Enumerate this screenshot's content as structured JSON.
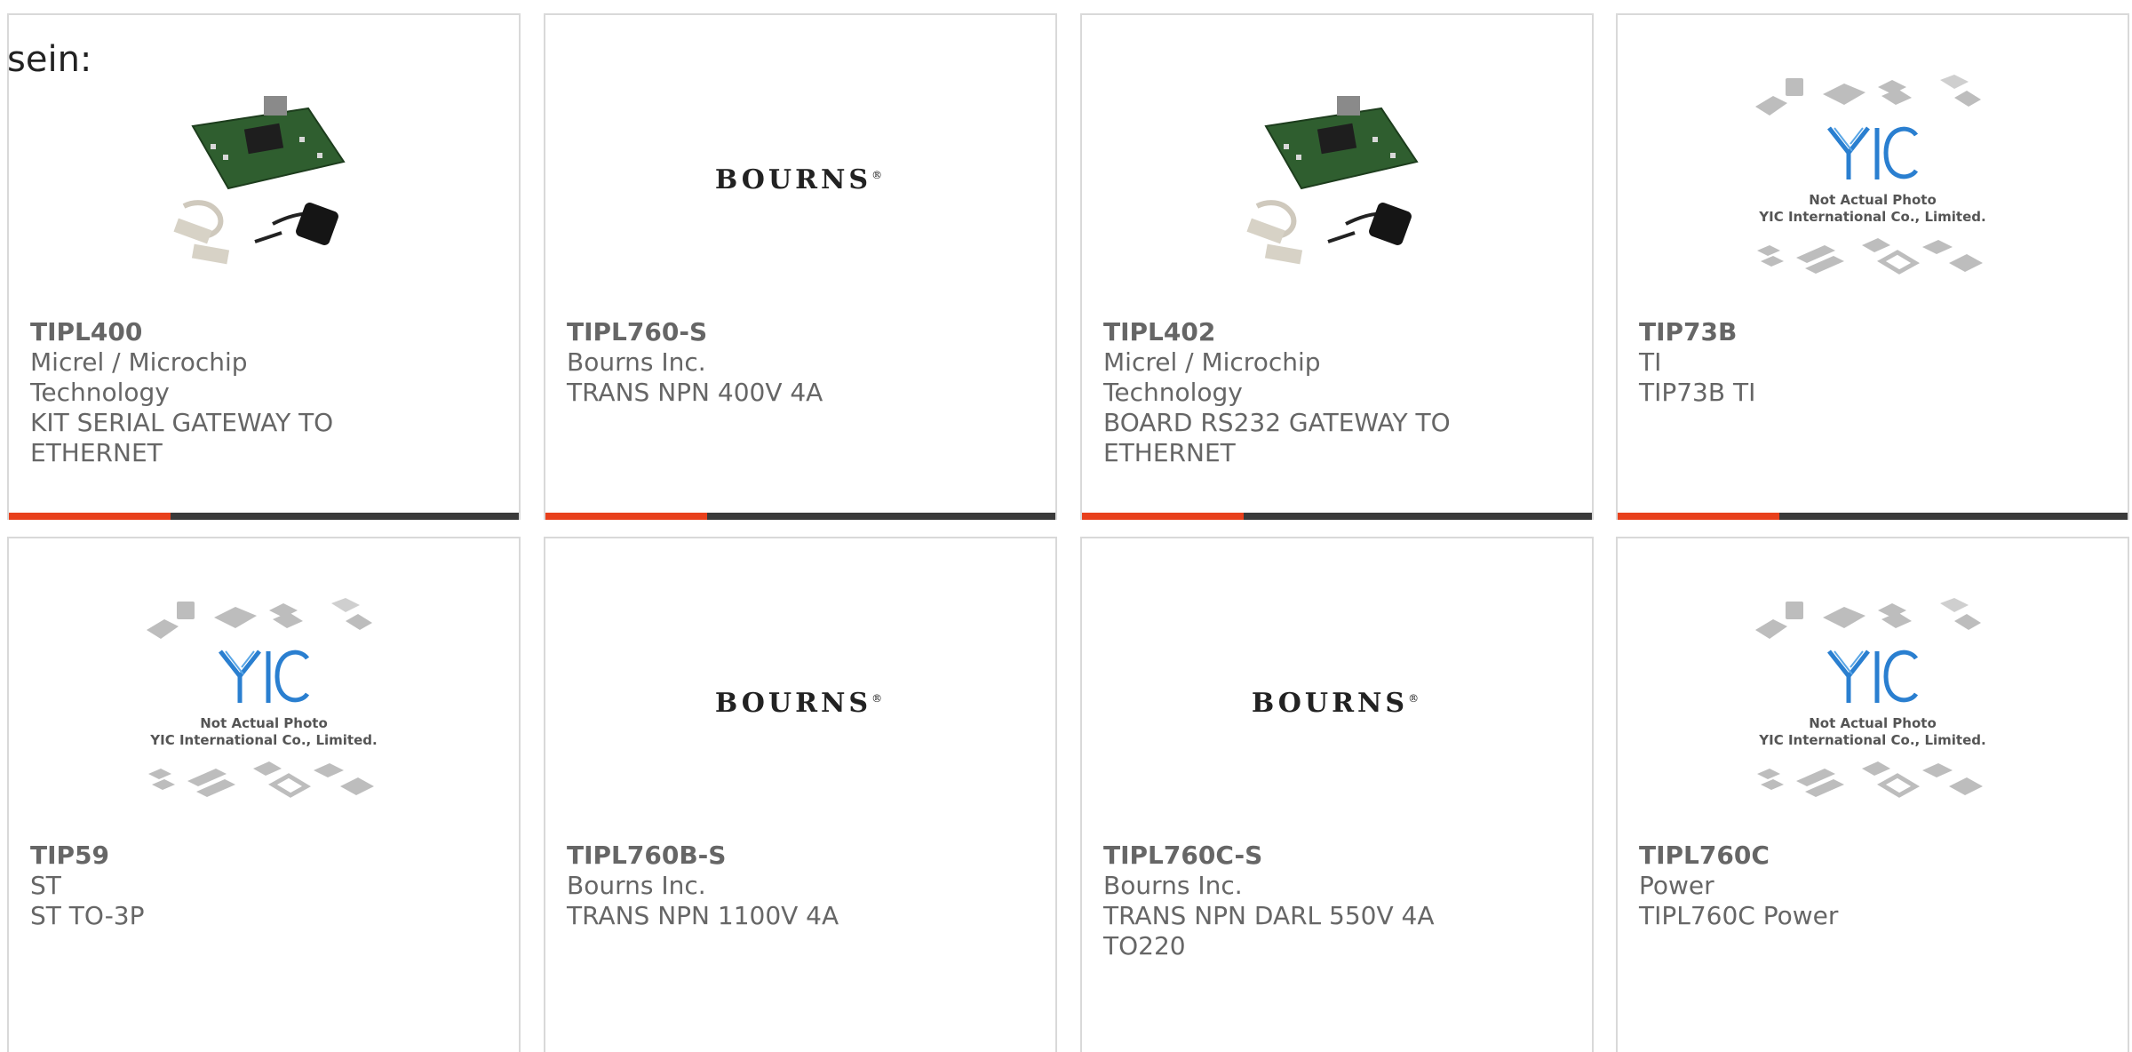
{
  "page": {
    "prefix": "sein:"
  },
  "colors": {
    "accent": "#e8401c",
    "bar": "#3a3a3a",
    "border": "#d9d9d9"
  },
  "products": [
    {
      "part": "TIPL400",
      "manufacturer": "Micrel / Microchip Technology",
      "description": "KIT SERIAL GATEWAY TO ETHERNET",
      "image": "dev-board-kit"
    },
    {
      "part": "TIPL760-S",
      "manufacturer": "Bourns Inc.",
      "description": "TRANS NPN 400V 4A",
      "image": "bourns-logo"
    },
    {
      "part": "TIPL402",
      "manufacturer": "Micrel / Microchip Technology",
      "description": "BOARD RS232 GATEWAY TO ETHERNET",
      "image": "dev-board-kit"
    },
    {
      "part": "TIP73B",
      "manufacturer": "TI",
      "description": "TIP73B TI",
      "image": "yic-placeholder"
    },
    {
      "part": "TIP59",
      "manufacturer": "ST",
      "description": "ST TO-3P",
      "image": "yic-placeholder"
    },
    {
      "part": "TIPL760B-S",
      "manufacturer": "Bourns Inc.",
      "description": "TRANS NPN 1100V 4A",
      "image": "bourns-logo"
    },
    {
      "part": "TIPL760C-S",
      "manufacturer": "Bourns Inc.",
      "description": "TRANS NPN DARL 550V 4A TO220",
      "image": "bourns-logo"
    },
    {
      "part": "TIPL760C",
      "manufacturer": "Power",
      "description": "TIPL760C Power",
      "image": "yic-placeholder"
    }
  ],
  "logos": {
    "bourns": "BOURNS",
    "bourns_mark": "®",
    "yic_not_actual": "Not Actual Photo",
    "yic_company": "YIC International Co., Limited."
  }
}
